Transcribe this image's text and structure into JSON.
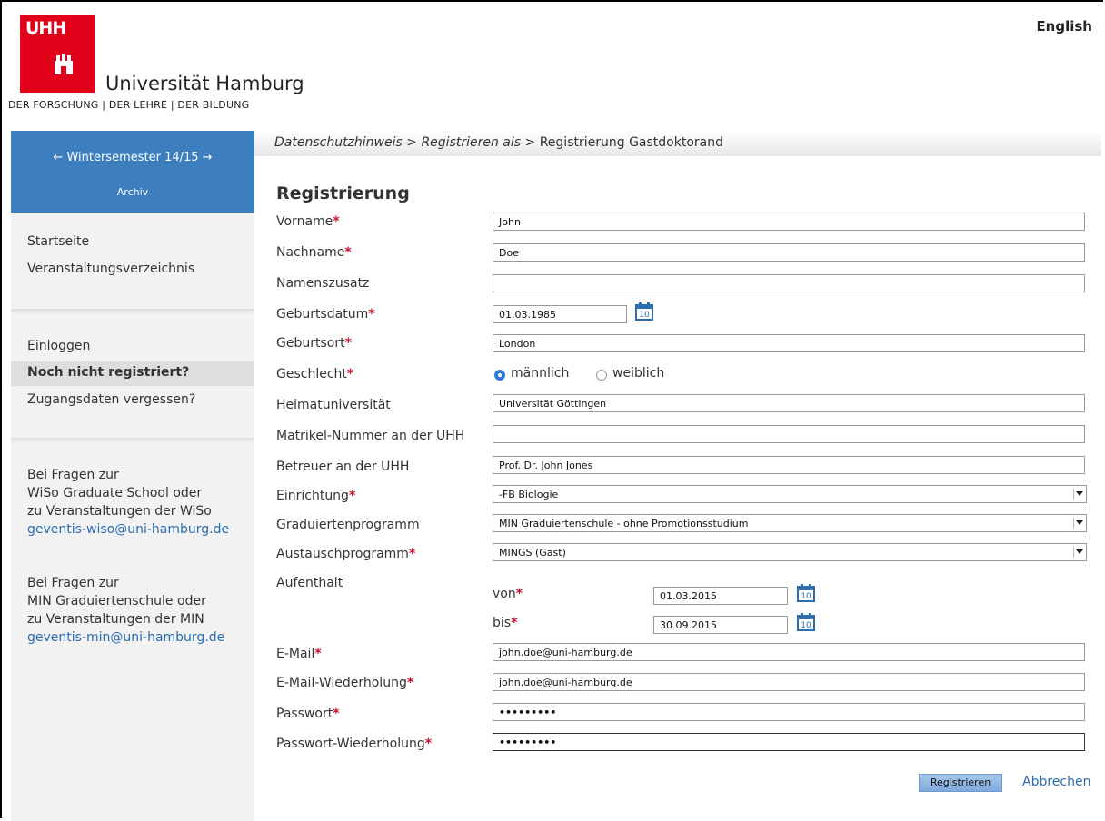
{
  "header": {
    "logo_text": "UHH",
    "university": "Universität Hamburg",
    "tagline": "DER FORSCHUNG | DER LEHRE | DER BILDUNG",
    "language_link": "English"
  },
  "breadcrumb": {
    "step1": "Datenschutzhinweis",
    "sep1": ">",
    "step2": "Registrieren als",
    "sep2": ">",
    "current": "Registrierung Gastdoktorand"
  },
  "sidebar": {
    "semester": "← Wintersemester 14/15 →",
    "archive": "Archiv",
    "nav": [
      "Startseite",
      "Veranstaltungsverzeichnis"
    ],
    "account": [
      "Einloggen",
      "Noch nicht registriert?",
      "Zugangsdaten vergessen?"
    ],
    "contact1": {
      "line1": "Bei Fragen zur",
      "line2": "WiSo Graduate School oder",
      "line3": "zu Veranstaltungen der WiSo",
      "email": "geventis-wiso@uni-hamburg.de"
    },
    "contact2": {
      "line1": "Bei Fragen zur",
      "line2": "MIN Graduiertenschule oder",
      "line3": "zu Veranstaltungen der MIN",
      "email": "geventis-min@uni-hamburg.de"
    }
  },
  "form": {
    "title": "Registrierung",
    "required_marker": "*",
    "labels": {
      "vorname": "Vorname",
      "nachname": "Nachname",
      "namenszusatz": "Namenszusatz",
      "geburtsdatum": "Geburtsdatum",
      "geburtsort": "Geburtsort",
      "geschlecht": "Geschlecht",
      "heimatuniversitaet": "Heimatuniversität",
      "matrikel": "Matrikel-Nummer an der UHH",
      "betreuer": "Betreuer an der UHH",
      "einrichtung": "Einrichtung",
      "graduiertenprogramm": "Graduiertenprogramm",
      "austauschprogramm": "Austauschprogramm",
      "aufenthalt": "Aufenthalt",
      "von": "von",
      "bis": "bis",
      "email": "E-Mail",
      "email_repeat": "E-Mail-Wiederholung",
      "passwort": "Passwort",
      "passwort_repeat": "Passwort-Wiederholung"
    },
    "values": {
      "vorname": "John",
      "nachname": "Doe",
      "namenszusatz": "",
      "geburtsdatum": "01.03.1985",
      "geburtsort": "London",
      "heimatuniversitaet": "Universität Göttingen",
      "matrikel": "",
      "betreuer": "Prof. Dr. John Jones",
      "einrichtung": "-FB Biologie",
      "graduiertenprogramm": "MIN Graduiertenschule - ohne Promotionsstudium",
      "austauschprogramm": "MINGS (Gast)",
      "von": "01.03.2015",
      "bis": "30.09.2015",
      "email": "john.doe@uni-hamburg.de",
      "email_repeat": "john.doe@uni-hamburg.de",
      "passwort": "•••••••••",
      "passwort_repeat": "•••••••••"
    },
    "gender_options": {
      "male": "männlich",
      "female": "weiblich",
      "selected": "male"
    },
    "calendar_icon_text": "10",
    "submit_label": "Registrieren",
    "cancel_label": "Abbrechen"
  },
  "colors": {
    "accent_red": "#e2001a",
    "sidebar_blue": "#3d7ebf",
    "link_blue": "#2a6db0"
  }
}
